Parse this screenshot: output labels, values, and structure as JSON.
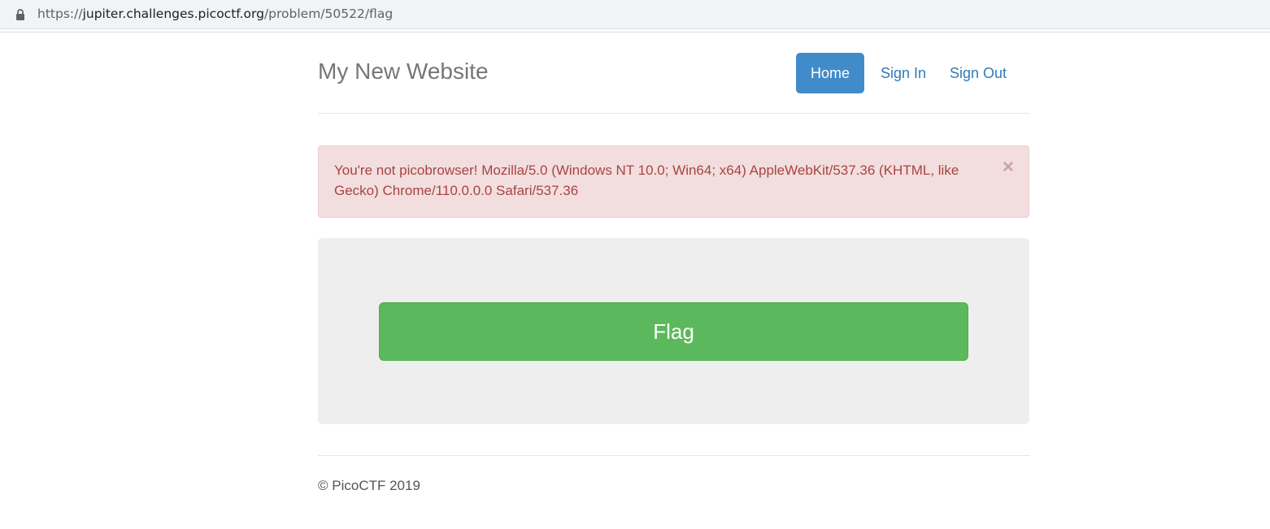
{
  "browser": {
    "url_scheme": "https://",
    "url_host": "jupiter.challenges.picoctf.org",
    "url_path": "/problem/50522/flag",
    "lock_icon": "lock-icon"
  },
  "header": {
    "site_title": "My New Website",
    "nav": [
      {
        "label": "Home",
        "active": true
      },
      {
        "label": "Sign In",
        "active": false
      },
      {
        "label": "Sign Out",
        "active": false
      }
    ]
  },
  "alert": {
    "message": "You're not picobrowser! Mozilla/5.0 (Windows NT 10.0; Win64; x64) AppleWebKit/537.36 (KHTML, like Gecko) Chrome/110.0.0.0 Safari/537.36",
    "close_symbol": "×"
  },
  "main": {
    "flag_button_label": "Flag"
  },
  "footer": {
    "text": "© PicoCTF 2019"
  },
  "colors": {
    "primary": "#428bca",
    "link": "#337ab7",
    "success": "#5cb85c",
    "danger_bg": "#f2dede",
    "danger_text": "#a94442"
  }
}
